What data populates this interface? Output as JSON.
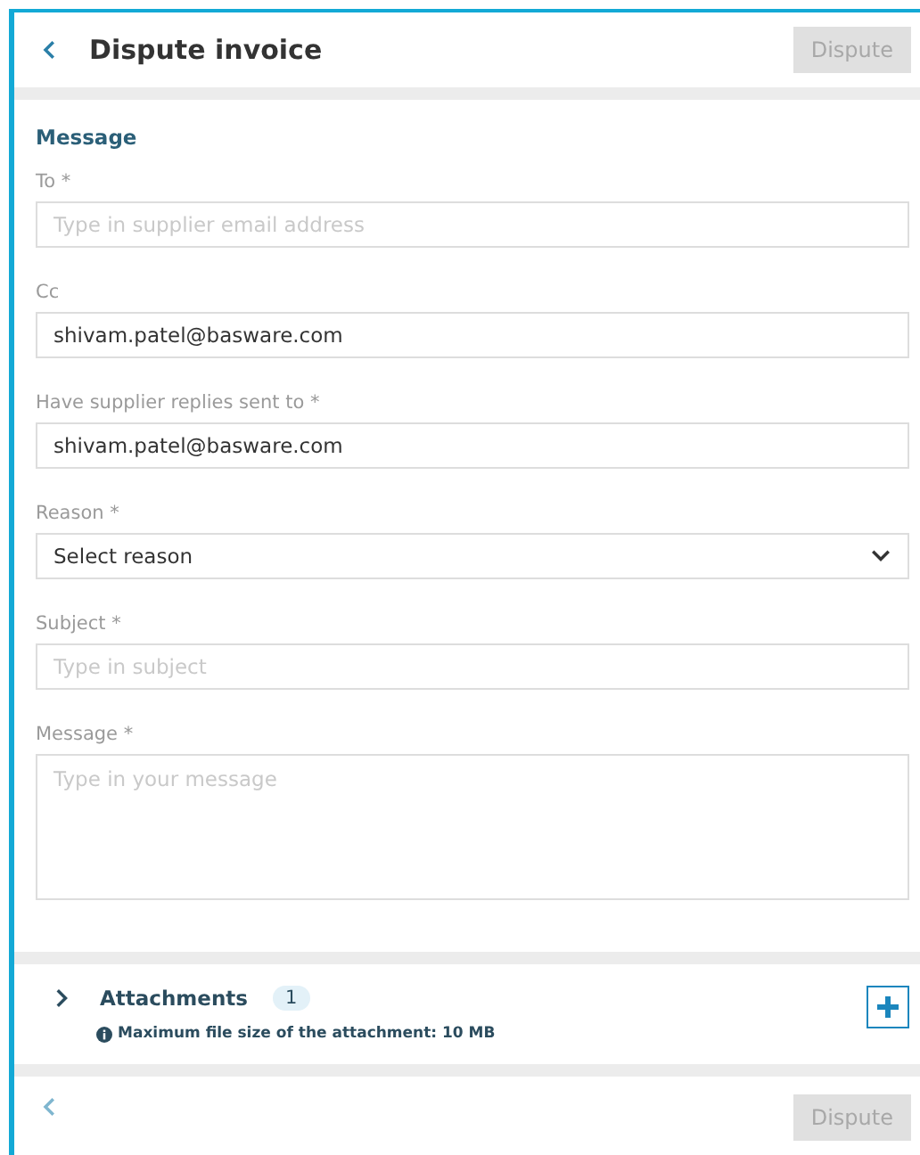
{
  "header": {
    "title": "Dispute invoice",
    "action": {
      "label": "Dispute",
      "disabled": true
    }
  },
  "section_title": "Message",
  "fields": [
    {
      "kind": "text",
      "label": "To *",
      "placeholder": "Type in supplier email address"
    },
    {
      "kind": "text",
      "label": "Cc",
      "value": "shivam.patel@basware.com"
    },
    {
      "kind": "text",
      "label": "Have supplier replies sent to *",
      "value": "shivam.patel@basware.com"
    },
    {
      "kind": "select",
      "label": "Reason *",
      "value": "Select reason"
    },
    {
      "kind": "text",
      "label": "Subject *",
      "placeholder": "Type in subject"
    },
    {
      "kind": "textarea",
      "label": "Message *",
      "placeholder": "Type in your message"
    }
  ],
  "attachments": {
    "label": "Attachments",
    "count": "1",
    "expanded": false,
    "note": "Maximum file size of the attachment: 10 MB"
  },
  "footer": {
    "action": {
      "label": "Dispute",
      "disabled": true
    }
  }
}
